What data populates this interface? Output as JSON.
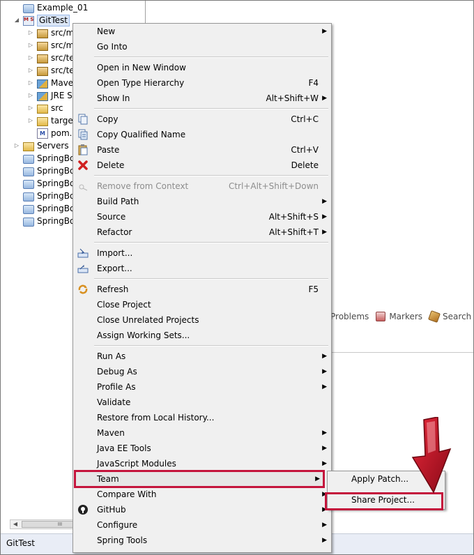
{
  "tree": {
    "items": [
      {
        "label": "Example_01",
        "icon": "folder-icon"
      },
      {
        "label": "GitTest",
        "icon": "project-icon"
      },
      {
        "label": "src/m",
        "icon": "package-icon"
      },
      {
        "label": "src/m",
        "icon": "package-icon"
      },
      {
        "label": "src/te",
        "icon": "package-icon"
      },
      {
        "label": "src/te",
        "icon": "package-icon"
      },
      {
        "label": "Mave",
        "icon": "library-icon"
      },
      {
        "label": "JRE Sy",
        "icon": "library-icon"
      },
      {
        "label": "src",
        "icon": "folder-icon"
      },
      {
        "label": "target",
        "icon": "folder-icon"
      },
      {
        "label": "pom.x",
        "icon": "pom-file-icon"
      },
      {
        "label": "Servers",
        "icon": "folder-icon"
      },
      {
        "label": "SpringBo",
        "icon": "folder-icon"
      },
      {
        "label": "SpringBo",
        "icon": "folder-icon"
      },
      {
        "label": "SpringBo",
        "icon": "folder-icon"
      },
      {
        "label": "SpringBo",
        "icon": "folder-icon"
      },
      {
        "label": "SpringBo",
        "icon": "folder-icon"
      },
      {
        "label": "SpringBo",
        "icon": "folder-icon"
      }
    ],
    "scroll_thumb": "III"
  },
  "views": {
    "tabs": [
      {
        "label": "Problems"
      },
      {
        "label": "Markers"
      },
      {
        "label": "Search"
      }
    ]
  },
  "status": {
    "text": "GitTest"
  },
  "menu": {
    "items": [
      {
        "label": "New",
        "shortcut": "",
        "submenu": true
      },
      {
        "label": "Go Into",
        "shortcut": ""
      },
      {
        "label": "Open in New Window",
        "shortcut": ""
      },
      {
        "label": "Open Type Hierarchy",
        "shortcut": "F4"
      },
      {
        "label": "Show In",
        "shortcut": "Alt+Shift+W",
        "submenu": true
      },
      {
        "label": "Copy",
        "shortcut": "Ctrl+C",
        "icon": "copy-icon"
      },
      {
        "label": "Copy Qualified Name",
        "shortcut": "",
        "icon": "copy-qualified-name-icon"
      },
      {
        "label": "Paste",
        "shortcut": "Ctrl+V",
        "icon": "paste-icon"
      },
      {
        "label": "Delete",
        "shortcut": "Delete",
        "icon": "delete-icon"
      },
      {
        "label": "Remove from Context",
        "shortcut": "Ctrl+Alt+Shift+Down",
        "disabled": true,
        "icon": "remove-context-icon"
      },
      {
        "label": "Build Path",
        "shortcut": "",
        "submenu": true
      },
      {
        "label": "Source",
        "shortcut": "Alt+Shift+S",
        "submenu": true
      },
      {
        "label": "Refactor",
        "shortcut": "Alt+Shift+T",
        "submenu": true
      },
      {
        "label": "Import...",
        "shortcut": "",
        "icon": "import-icon"
      },
      {
        "label": "Export...",
        "shortcut": "",
        "icon": "export-icon"
      },
      {
        "label": "Refresh",
        "shortcut": "F5",
        "icon": "refresh-icon"
      },
      {
        "label": "Close Project",
        "shortcut": ""
      },
      {
        "label": "Close Unrelated Projects",
        "shortcut": ""
      },
      {
        "label": "Assign Working Sets...",
        "shortcut": ""
      },
      {
        "label": "Run As",
        "shortcut": "",
        "submenu": true
      },
      {
        "label": "Debug As",
        "shortcut": "",
        "submenu": true
      },
      {
        "label": "Profile As",
        "shortcut": "",
        "submenu": true
      },
      {
        "label": "Validate",
        "shortcut": ""
      },
      {
        "label": "Restore from Local History...",
        "shortcut": ""
      },
      {
        "label": "Maven",
        "shortcut": "",
        "submenu": true
      },
      {
        "label": "Java EE Tools",
        "shortcut": "",
        "submenu": true
      },
      {
        "label": "JavaScript Modules",
        "shortcut": "",
        "submenu": true
      },
      {
        "label": "Team",
        "shortcut": "",
        "submenu": true,
        "highlighted": true
      },
      {
        "label": "Compare With",
        "shortcut": "",
        "submenu": true
      },
      {
        "label": "GitHub",
        "shortcut": "",
        "submenu": true,
        "icon": "github-icon"
      },
      {
        "label": "Configure",
        "shortcut": "",
        "submenu": true
      },
      {
        "label": "Spring Tools",
        "shortcut": "",
        "submenu": true
      }
    ]
  },
  "team_submenu": {
    "items": [
      {
        "label": "Apply Patch..."
      },
      {
        "label": "Share Project...",
        "highlighted": true
      }
    ]
  },
  "colors": {
    "highlight_border": "#c4143c",
    "arrow": "#b0102a",
    "menu_bg": "#f0f0f0",
    "status_bg": "#e9edf6"
  }
}
